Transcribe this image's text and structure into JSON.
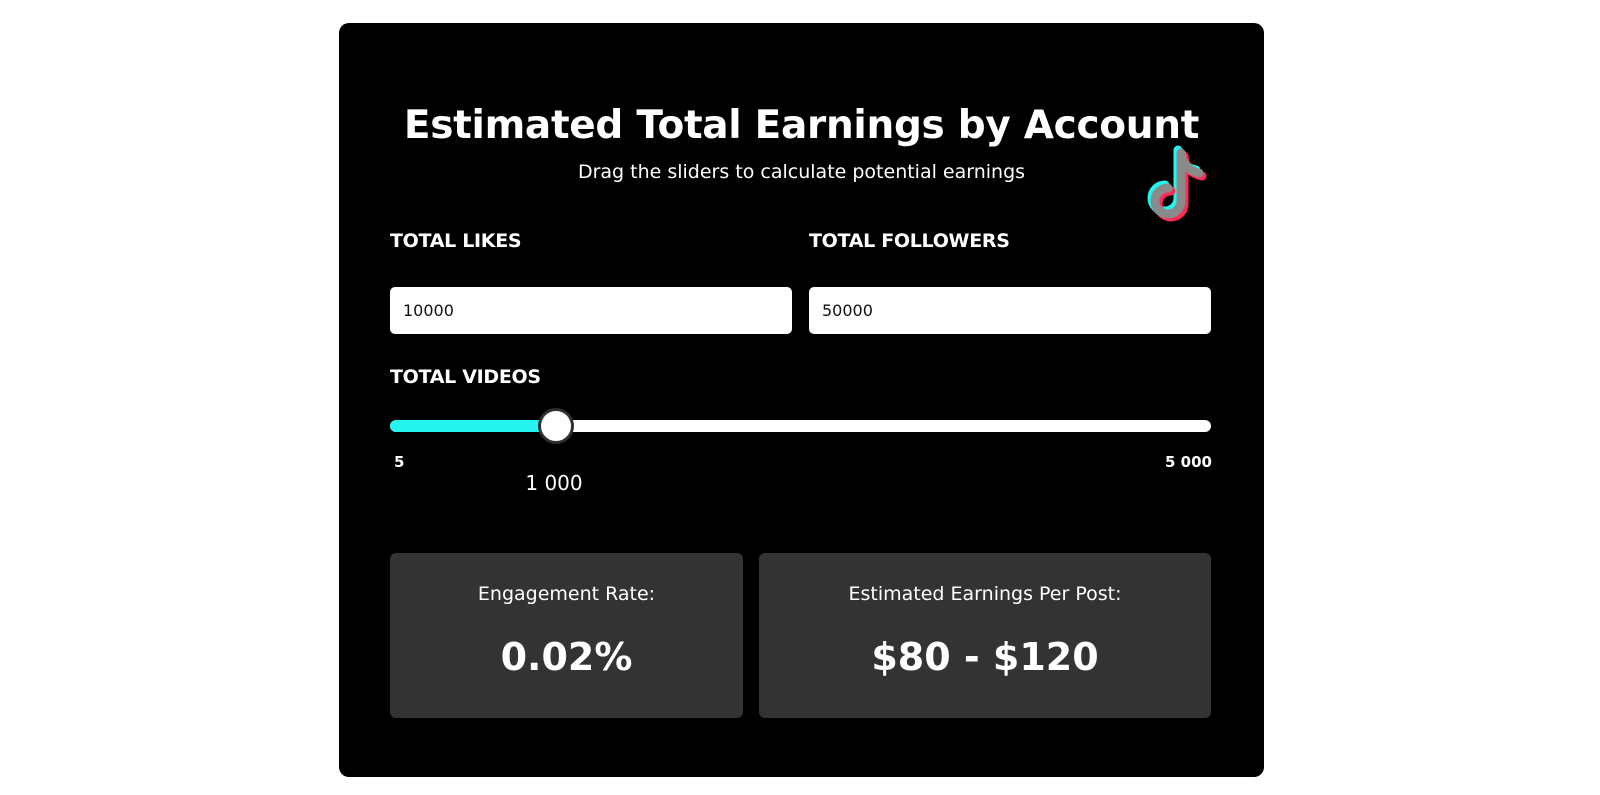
{
  "header": {
    "title": "Estimated Total Earnings by Account",
    "subtitle": "Drag the sliders to calculate potential earnings",
    "logo_icon": "tiktok-logo-icon"
  },
  "inputs": {
    "likes_label": "TOTAL LIKES",
    "likes_value": "10000",
    "followers_label": "TOTAL FOLLOWERS",
    "followers_value": "50000"
  },
  "videos_slider": {
    "label": "TOTAL VIDEOS",
    "min_label": "5",
    "max_label": "5 000",
    "value_label": "1 000",
    "min": 5,
    "max": 5000,
    "value": 1000
  },
  "results": {
    "engagement_label": "Engagement Rate:",
    "engagement_value": "0.02%",
    "earnings_label": "Estimated Earnings Per Post:",
    "earnings_value": "$80 - $120"
  },
  "colors": {
    "background": "#ffffff",
    "card": "#000000",
    "panel": "#333333",
    "slider_fill": "#25f4ee",
    "logo_cyan": "#25f4ee",
    "logo_red": "#fe2c55",
    "logo_gray": "#8a8a8a"
  }
}
